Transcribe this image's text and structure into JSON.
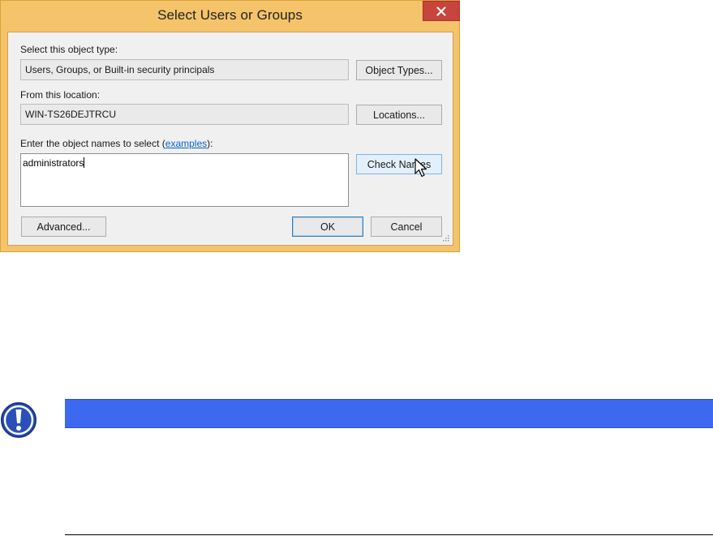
{
  "dialog": {
    "title": "Select Users or Groups",
    "object_type_label": "Select this object type:",
    "object_type_value": "Users, Groups, or Built-in security principals",
    "object_types_button": "Object Types...",
    "location_label": "From this location:",
    "location_value": "WIN-TS26DEJTRCU",
    "locations_button": "Locations...",
    "names_label_prefix": "Enter the object names to select (",
    "names_label_link": "examples",
    "names_label_suffix": "):",
    "names_value": "administrators",
    "check_names_button": "Check Names",
    "advanced_button": "Advanced...",
    "ok_button": "OK",
    "cancel_button": "Cancel"
  },
  "colors": {
    "frame": "#f4c36a",
    "close": "#c7453c",
    "link": "#0066cc",
    "note_bar": "#3d68f0",
    "note_icon": "#2a4fb8"
  },
  "icons": {
    "close": "close-icon",
    "cursor": "mouse-pointer-icon",
    "grip": "resize-grip-icon",
    "note": "important-exclamation-icon"
  }
}
